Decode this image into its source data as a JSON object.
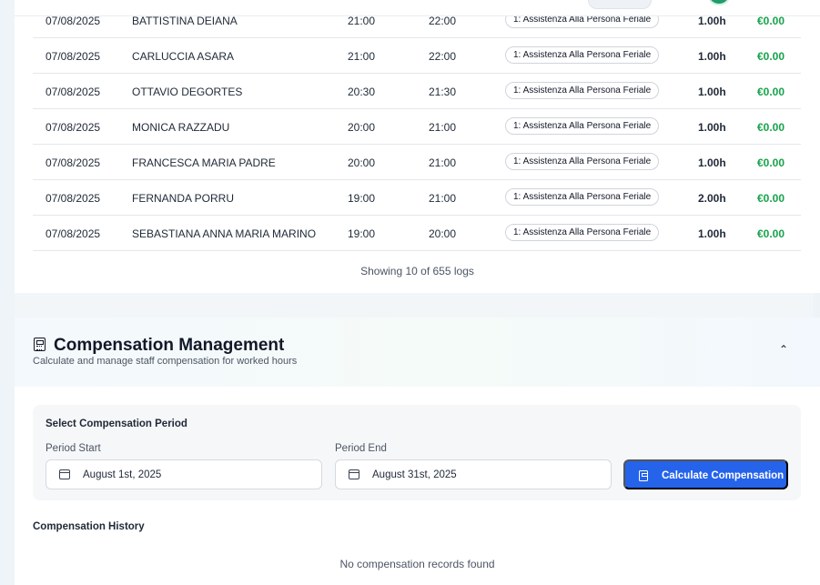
{
  "logs": {
    "rows": [
      {
        "date": "07/08/2025",
        "name": "BATTISTINA DEIANA",
        "start": "21:00",
        "end": "22:00",
        "type": "1: Assistenza Alla Persona Feriale",
        "hours": "1.00h",
        "amount": "€0.00"
      },
      {
        "date": "07/08/2025",
        "name": "CARLUCCIA ASARA",
        "start": "21:00",
        "end": "22:00",
        "type": "1: Assistenza Alla Persona Feriale",
        "hours": "1.00h",
        "amount": "€0.00"
      },
      {
        "date": "07/08/2025",
        "name": "OTTAVIO DEGORTES",
        "start": "20:30",
        "end": "21:30",
        "type": "1: Assistenza Alla Persona Feriale",
        "hours": "1.00h",
        "amount": "€0.00"
      },
      {
        "date": "07/08/2025",
        "name": "MONICA RAZZADU",
        "start": "20:00",
        "end": "21:00",
        "type": "1: Assistenza Alla Persona Feriale",
        "hours": "1.00h",
        "amount": "€0.00"
      },
      {
        "date": "07/08/2025",
        "name": "FRANCESCA MARIA PADRE",
        "start": "20:00",
        "end": "21:00",
        "type": "1: Assistenza Alla Persona Feriale",
        "hours": "1.00h",
        "amount": "€0.00"
      },
      {
        "date": "07/08/2025",
        "name": "FERNANDA PORRU",
        "start": "19:00",
        "end": "21:00",
        "type": "1: Assistenza Alla Persona Feriale",
        "hours": "2.00h",
        "amount": "€0.00"
      },
      {
        "date": "07/08/2025",
        "name": "SEBASTIANA ANNA MARIA MARINO",
        "start": "19:00",
        "end": "20:00",
        "type": "1: Assistenza Alla Persona Feriale",
        "hours": "1.00h",
        "amount": "€0.00"
      }
    ],
    "showing": "Showing 10 of 655 logs"
  },
  "compensation": {
    "icon": "calculator-icon",
    "title": "Compensation Management",
    "subtitle": "Calculate and manage staff compensation for worked hours",
    "period": {
      "title": "Select Compensation Period",
      "start_label": "Period Start",
      "start_value": "August 1st, 2025",
      "end_label": "Period End",
      "end_value": "August 31st, 2025",
      "button_label": "Calculate Compensation"
    },
    "history_title": "Compensation History",
    "empty_text": "No compensation records found"
  },
  "colors": {
    "accent": "#2563eb",
    "amount": "#16a34a"
  }
}
